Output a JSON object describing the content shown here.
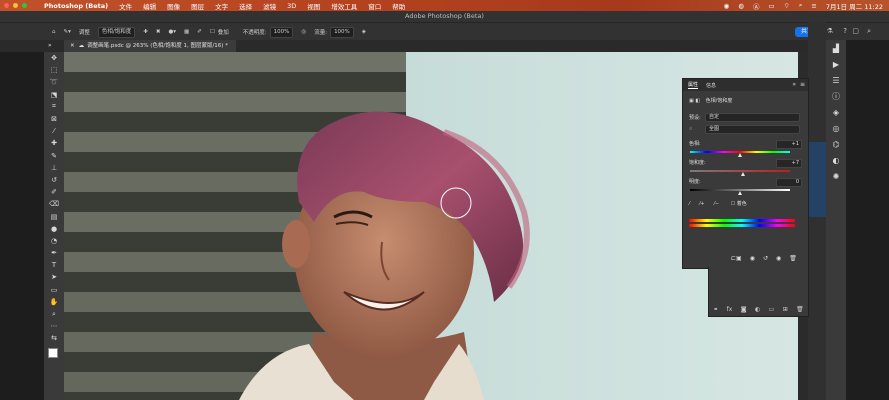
{
  "menubar": {
    "app_name": "Photoshop (Beta)",
    "items": [
      "文件",
      "编辑",
      "图像",
      "图层",
      "文字",
      "选择",
      "滤镜",
      "3D",
      "视图",
      "增效工具",
      "窗口",
      "帮助"
    ],
    "status": {
      "datetime": "7月1日 周二 11:22"
    }
  },
  "window": {
    "title": "Adobe Photoshop (Beta)"
  },
  "options_bar": {
    "label_adjust": "调整",
    "preset_value": "色相/饱和度",
    "sample_all": "叠加",
    "opacity_label": "不透明度:",
    "opacity_value": "100%",
    "flow_label": "流量:",
    "flow_value": "100%",
    "share_label": "共享"
  },
  "document_tab": {
    "label": "调整画笔.psdc @ 263% (色相/饱和度 1, 图层蒙版/16) *"
  },
  "properties_panel": {
    "tabs": [
      "属性",
      "信息"
    ],
    "adjustment_name": "色相/饱和度",
    "preset_label": "预设:",
    "preset_value": "自定",
    "channel_value": "全图",
    "hue_label": "色相:",
    "hue_value": "+1",
    "saturation_label": "饱和度:",
    "saturation_value": "+7",
    "lightness_label": "明度:",
    "lightness_value": "0",
    "colorize_label": "着色",
    "hue_level": 0.5,
    "saturation_level": 0.53,
    "lightness_level": 0.5
  },
  "colors": {
    "menubar_accent": "#b5421f",
    "accent_blue": "#1473e6",
    "panel_bg": "#3a3a3a",
    "wall_color": "#cfe2df"
  }
}
